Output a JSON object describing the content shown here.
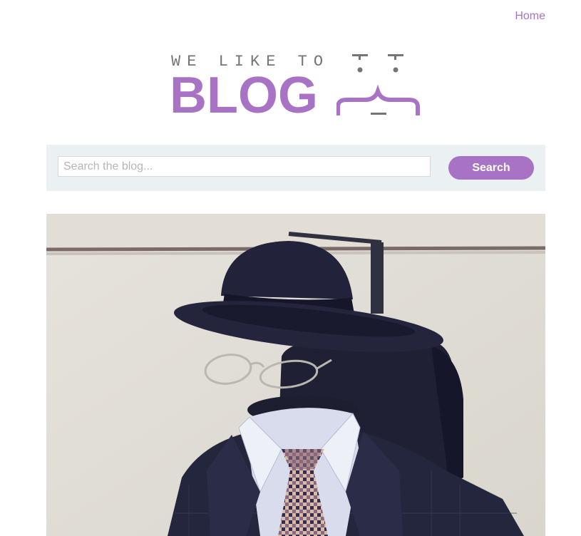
{
  "nav": {
    "home_label": "Home"
  },
  "logo": {
    "tagline": "WE LIKE TO",
    "word": "BLOG"
  },
  "search": {
    "placeholder": "Search the blog...",
    "value": "",
    "button_label": "Search"
  },
  "colors": {
    "accent": "#a873c4",
    "search_bar_bg": "#ebf0f2",
    "tagline": "#757575"
  },
  "post": {
    "image_icon": "invisible-man-photo"
  }
}
